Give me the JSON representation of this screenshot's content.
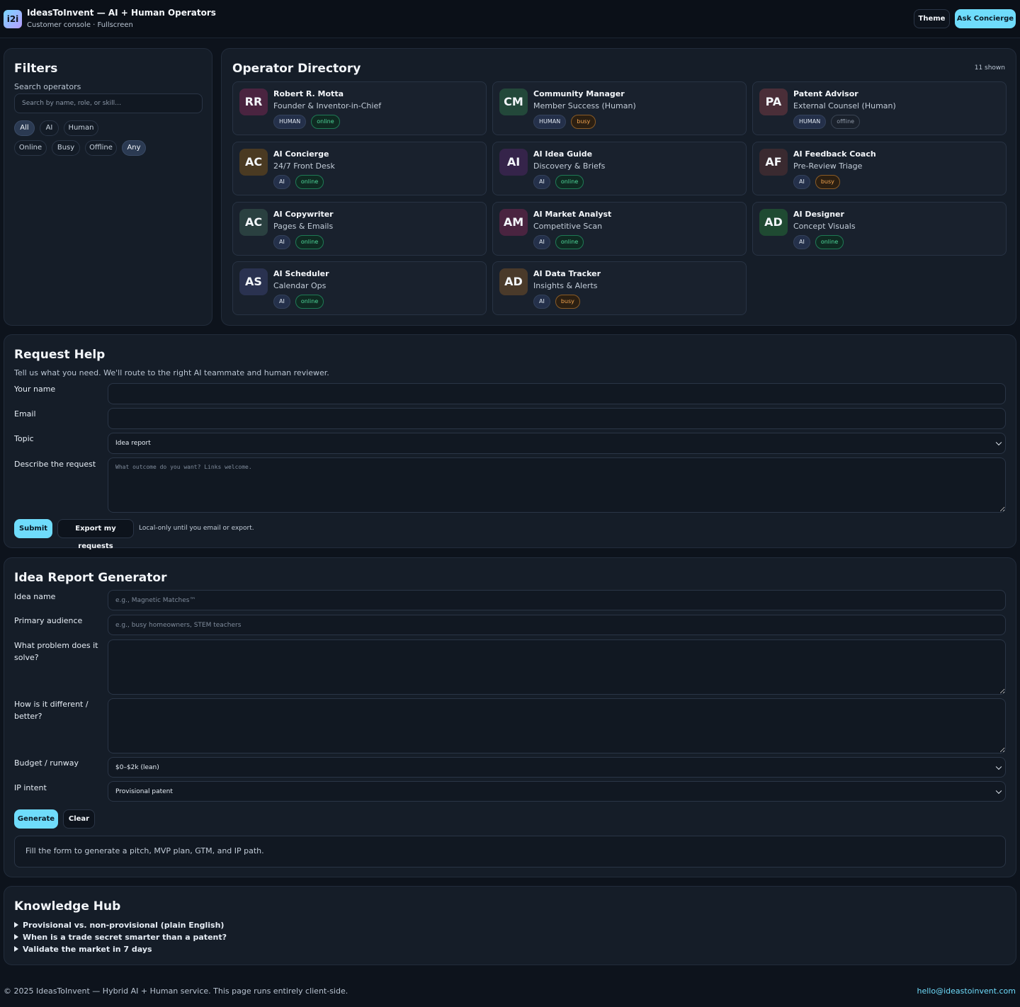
{
  "header": {
    "logo": "i2i",
    "title": "IdeasToInvent — AI + Human Operators",
    "subtitle": "Customer console · Fullscreen",
    "theme_label": "Theme",
    "ask_label": "Ask Concierge"
  },
  "filters": {
    "title": "Filters",
    "search_label": "Search operators",
    "search_placeholder": "Search by name, role, or skill…",
    "type_chips": [
      "All",
      "AI",
      "Human"
    ],
    "status_chips": [
      "Online",
      "Busy",
      "Offline",
      "Any"
    ],
    "active_type": "All",
    "active_status": "Any"
  },
  "directory": {
    "title": "Operator Directory",
    "count_text": "11 shown",
    "operators": [
      {
        "initials": "RR",
        "name": "Robert R. Motta",
        "role": "Founder & Inventor-in-Chief",
        "type": "HUMAN",
        "status": "online",
        "avatar_bg": "#4a2440"
      },
      {
        "initials": "CM",
        "name": "Community Manager",
        "role": "Member Success (Human)",
        "type": "HUMAN",
        "status": "busy",
        "avatar_bg": "#23483a"
      },
      {
        "initials": "PA",
        "name": "Patent Advisor",
        "role": "External Counsel (Human)",
        "type": "HUMAN",
        "status": "offline",
        "avatar_bg": "#4a2e38"
      },
      {
        "initials": "AC",
        "name": "AI Concierge",
        "role": "24/7 Front Desk",
        "type": "AI",
        "status": "online",
        "avatar_bg": "#4a3a22"
      },
      {
        "initials": "AI",
        "name": "AI Idea Guide",
        "role": "Discovery & Briefs",
        "type": "AI",
        "status": "online",
        "avatar_bg": "#35244a"
      },
      {
        "initials": "AF",
        "name": "AI Feedback Coach",
        "role": "Pre-Review Triage",
        "type": "AI",
        "status": "busy",
        "avatar_bg": "#3a2a30"
      },
      {
        "initials": "AC",
        "name": "AI Copywriter",
        "role": "Pages & Emails",
        "type": "AI",
        "status": "online",
        "avatar_bg": "#2a4040"
      },
      {
        "initials": "AM",
        "name": "AI Market Analyst",
        "role": "Competitive Scan",
        "type": "AI",
        "status": "online",
        "avatar_bg": "#4a2440"
      },
      {
        "initials": "AD",
        "name": "AI Designer",
        "role": "Concept Visuals",
        "type": "AI",
        "status": "online",
        "avatar_bg": "#1f4a32"
      },
      {
        "initials": "AS",
        "name": "AI Scheduler",
        "role": "Calendar Ops",
        "type": "AI",
        "status": "online",
        "avatar_bg": "#2a3250"
      },
      {
        "initials": "AD",
        "name": "AI Data Tracker",
        "role": "Insights & Alerts",
        "type": "AI",
        "status": "busy",
        "avatar_bg": "#4a3a2a"
      }
    ]
  },
  "request": {
    "title": "Request Help",
    "description": "Tell us what you need. We'll route to the right AI teammate and human reviewer.",
    "name_label": "Your name",
    "name_value": "",
    "email_label": "Email",
    "email_value": "",
    "topic_label": "Topic",
    "topic_value": "Idea report",
    "describe_label": "Describe the request",
    "describe_placeholder": "What outcome do you want? Links welcome.",
    "submit_label": "Submit",
    "export_label": "Export my requests",
    "note": "Local-only until you email or export."
  },
  "idea": {
    "title": "Idea Report Generator",
    "name_label": "Idea name",
    "name_placeholder": "e.g., Magnetic Matches™",
    "audience_label": "Primary audience",
    "audience_placeholder": "e.g., busy homeowners, STEM teachers",
    "problem_label": "What problem does it solve?",
    "different_label": "How is it different / better?",
    "budget_label": "Budget / runway",
    "budget_value": "$0–$2k (lean)",
    "ip_label": "IP intent",
    "ip_value": "Provisional patent",
    "generate_label": "Generate",
    "clear_label": "Clear",
    "output_text": "Fill the form to generate a pitch, MVP plan, GTM, and IP path."
  },
  "knowledge": {
    "title": "Knowledge Hub",
    "items": [
      "Provisional vs. non-provisional (plain English)",
      "When is a trade secret smarter than a patent?",
      "Validate the market in 7 days"
    ]
  },
  "footer": {
    "copyright": "© 2025 IdeasToInvent — Hybrid AI + Human service. This page runs entirely client-side.",
    "email": "hello@ideastoinvent.com"
  },
  "colors": {
    "accent": "#6fdcfb",
    "online": "#4ed69a",
    "busy": "#f3a44f",
    "offline": "#8f99a8"
  }
}
